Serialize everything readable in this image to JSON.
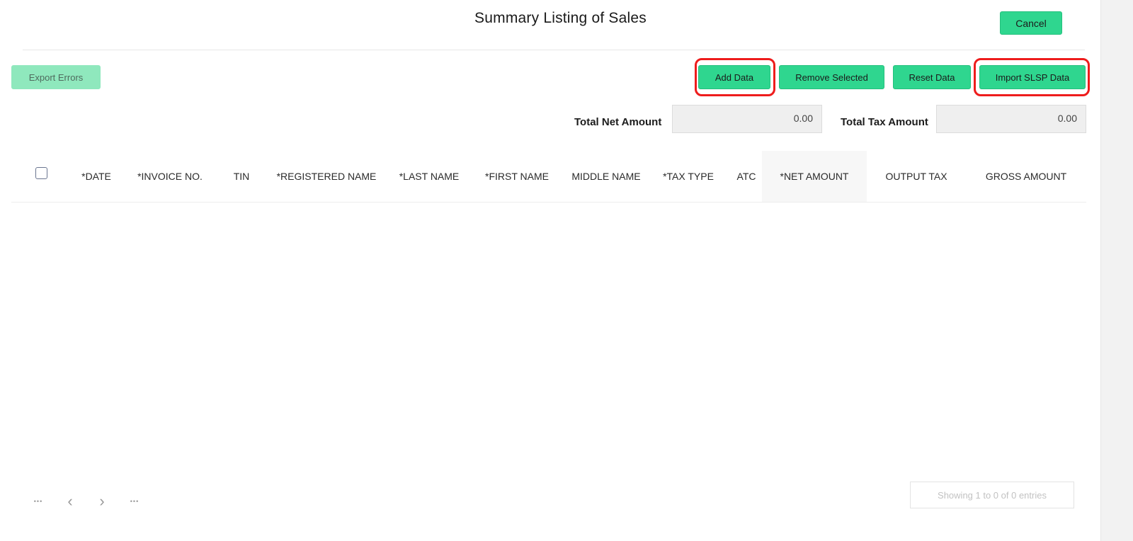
{
  "modal": {
    "title": "Summary Listing of Sales",
    "cancel_label": "Cancel"
  },
  "toolbar": {
    "export_errors_label": "Export Errors",
    "add_data_label": "Add Data",
    "remove_selected_label": "Remove Selected",
    "reset_data_label": "Reset Data",
    "import_slsp_label": "Import SLSP Data"
  },
  "totals": {
    "net_amount_label": "Total Net Amount",
    "net_amount_value": "0.00",
    "tax_amount_label": "Total Tax Amount",
    "tax_amount_value": "0.00"
  },
  "table": {
    "columns": [
      "*DATE",
      "*INVOICE NO.",
      "TIN",
      "*REGISTERED NAME",
      "*LAST NAME",
      "*FIRST NAME",
      "MIDDLE NAME",
      "*TAX TYPE",
      "ATC",
      "*NET AMOUNT",
      "OUTPUT TAX",
      "GROSS AMOUNT"
    ],
    "rows": []
  },
  "pagination": {
    "first_symbol": "•••",
    "prev_symbol": "‹",
    "next_symbol": "›",
    "last_symbol": "•••",
    "info": "Showing 1 to 0 of 0 entries"
  },
  "icons": {
    "first_page": "ellipsis-icon",
    "prev_page": "chevron-left-icon",
    "next_page": "chevron-right-icon",
    "last_page": "ellipsis-icon"
  },
  "colors": {
    "accent": "#2fd68f",
    "accent_disabled": "#8fe8bd",
    "highlight": "#ee1c1c"
  }
}
